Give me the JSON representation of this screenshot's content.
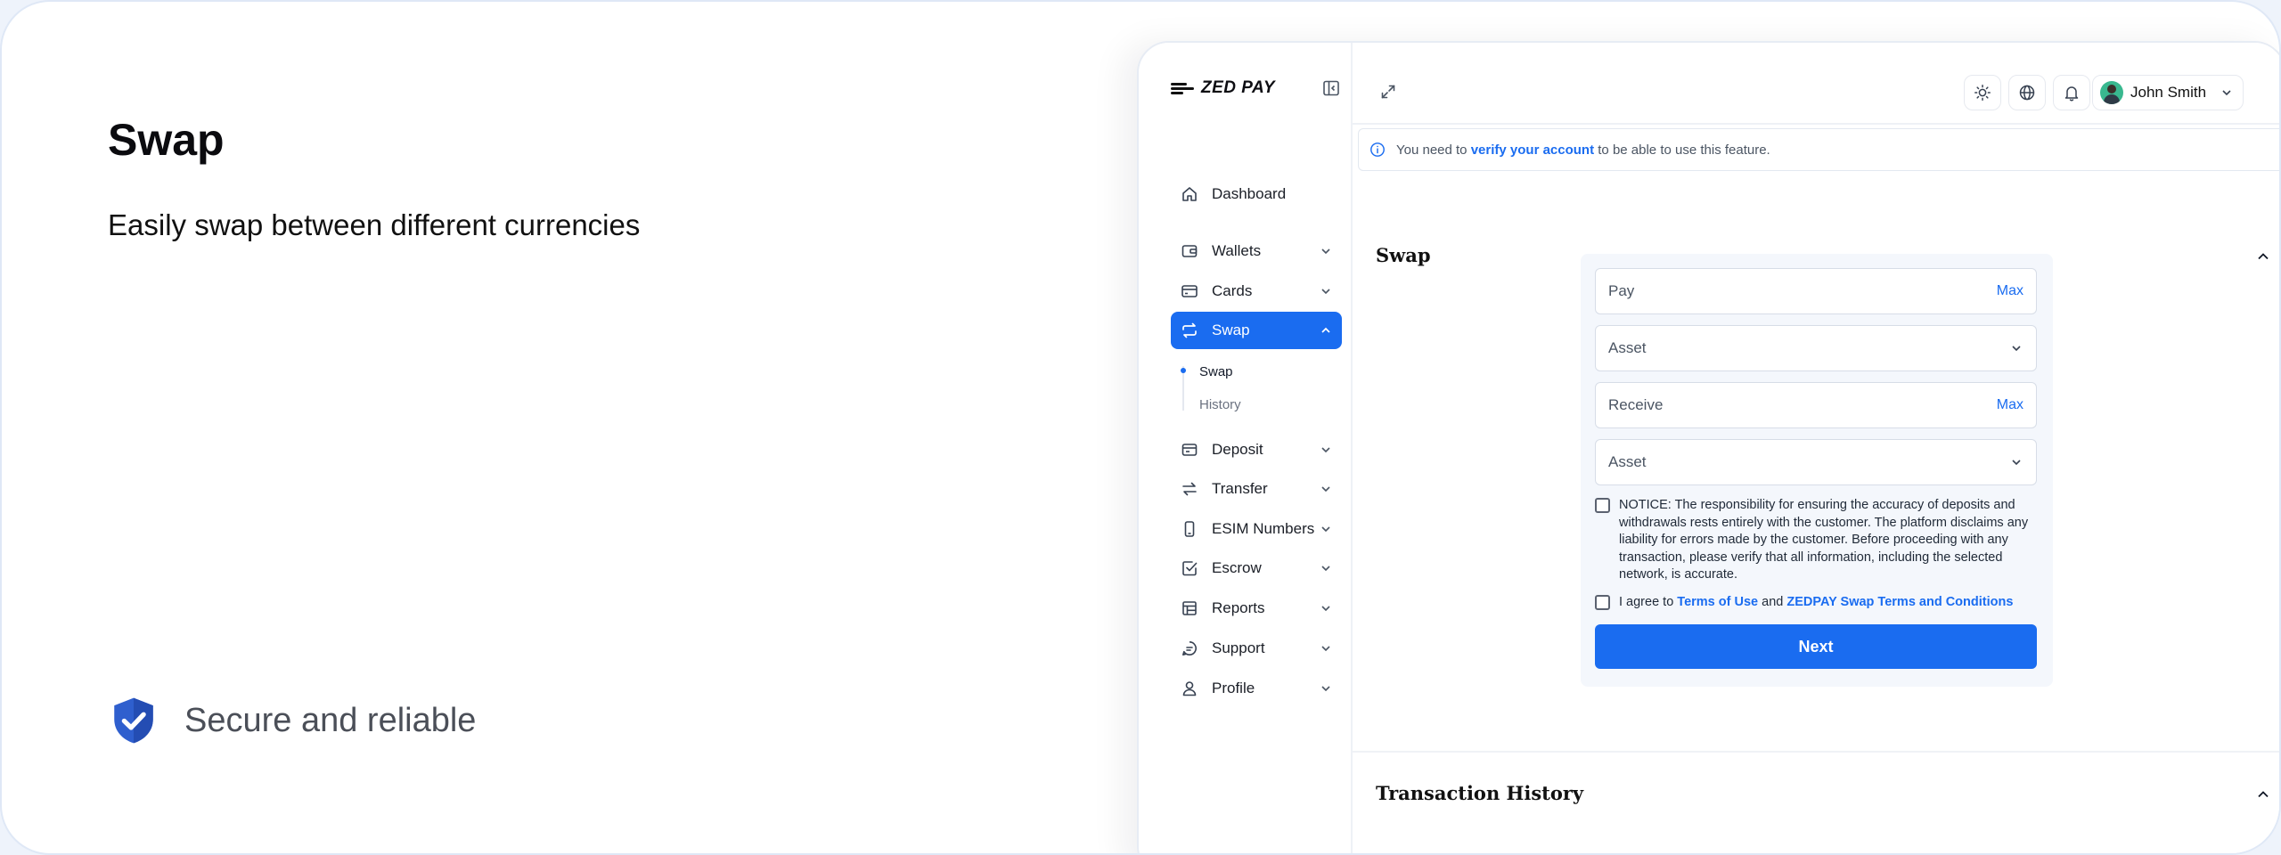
{
  "promo": {
    "title": "Swap",
    "subtitle": "Easily swap between different currencies",
    "badge_text": "Secure and reliable",
    "badge_icon": "shield-check-icon",
    "badge_color": "#2f5fce"
  },
  "brand": {
    "logo_text": "ZED PAY",
    "accent": "#1a6cf0"
  },
  "sidebar": {
    "items": [
      {
        "label": "Dashboard",
        "icon": "home-icon"
      },
      {
        "label": "Wallets",
        "icon": "wallet-icon"
      },
      {
        "label": "Cards",
        "icon": "card-icon"
      },
      {
        "label": "Swap",
        "icon": "swap-icon",
        "active": true
      },
      {
        "label": "Deposit",
        "icon": "deposit-icon"
      },
      {
        "label": "Transfer",
        "icon": "transfer-icon"
      },
      {
        "label": "ESIM Numbers",
        "icon": "phone-icon"
      },
      {
        "label": "Escrow",
        "icon": "checkbox-icon"
      },
      {
        "label": "Reports",
        "icon": "table-icon"
      },
      {
        "label": "Support",
        "icon": "chat-icon"
      },
      {
        "label": "Profile",
        "icon": "user-icon"
      }
    ],
    "swap_sub": [
      {
        "label": "Swap",
        "active": true
      },
      {
        "label": "History"
      }
    ]
  },
  "header": {
    "user_name": "John Smith",
    "icons": [
      "sun-icon",
      "globe-icon",
      "bell-icon"
    ]
  },
  "alert": {
    "before": "You need to",
    "link": "verify your account",
    "after": "to be able to use this feature."
  },
  "swap": {
    "section_title": "Swap",
    "pay_placeholder": "Pay",
    "max_label": "Max",
    "asset_placeholder": "Asset",
    "receive_placeholder": "Receive",
    "notice": "NOTICE: The responsibility for ensuring the accuracy of deposits and withdrawals rests entirely with the customer. The platform disclaims any liability for errors made by the customer. Before proceeding with any transaction, please verify that all information, including the selected network, is accurate.",
    "agree_prefix": "I agree to",
    "terms_link": "Terms of Use",
    "agree_and": "and",
    "swap_terms_link": "ZEDPAY Swap Terms and Conditions",
    "next_label": "Next"
  },
  "history": {
    "section_title": "Transaction History"
  }
}
